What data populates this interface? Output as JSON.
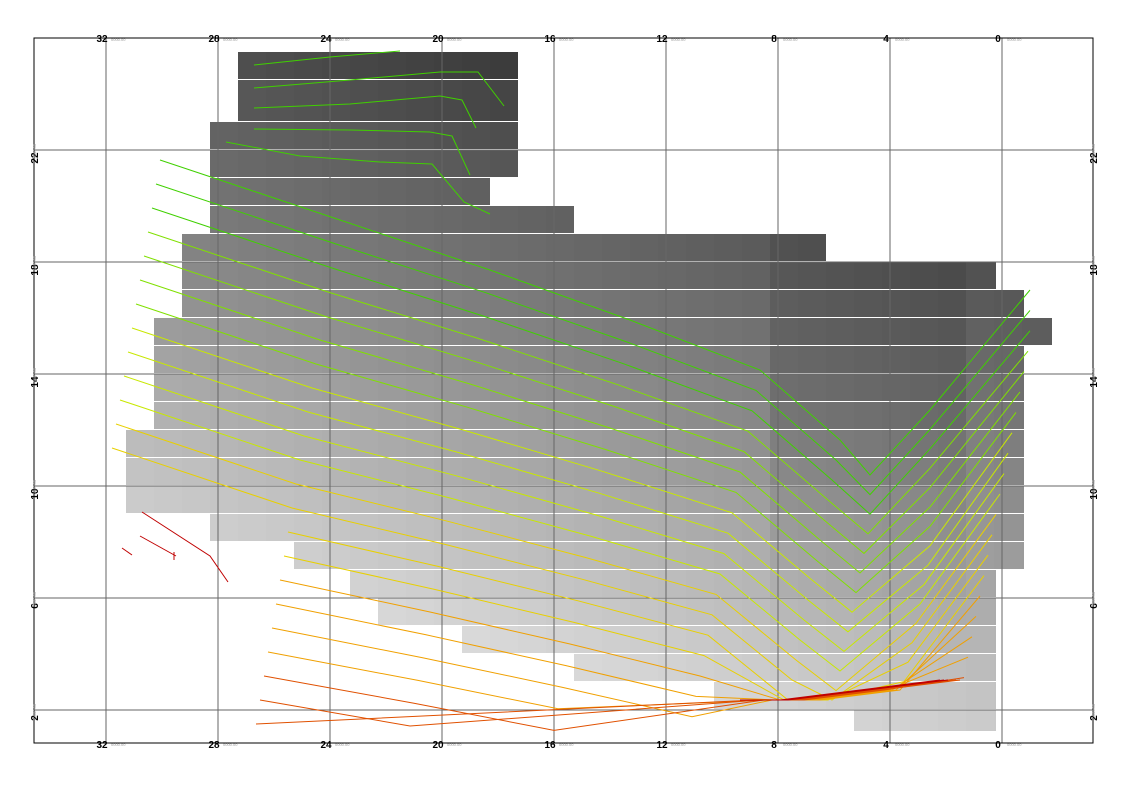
{
  "map": {
    "frame_bg": "#ffffff",
    "grid_color": "#666666",
    "x_ticks": [
      "32",
      "28",
      "24",
      "20",
      "16",
      "12",
      "8",
      "4",
      "0"
    ],
    "y_ticks": [
      "22",
      "18",
      "14",
      "10",
      "6",
      "2"
    ],
    "x_tick_suffix": "0000.00",
    "y_tick_suffix": "0000.00",
    "raster_palette": {
      "dark": "#1a1a1a",
      "light": "#f8f8f8"
    },
    "contour_palette": [
      "#c00000",
      "#e05000",
      "#f0a000",
      "#e8d000",
      "#c8e800",
      "#80e000",
      "#40d000"
    ],
    "contour_count": 26
  }
}
